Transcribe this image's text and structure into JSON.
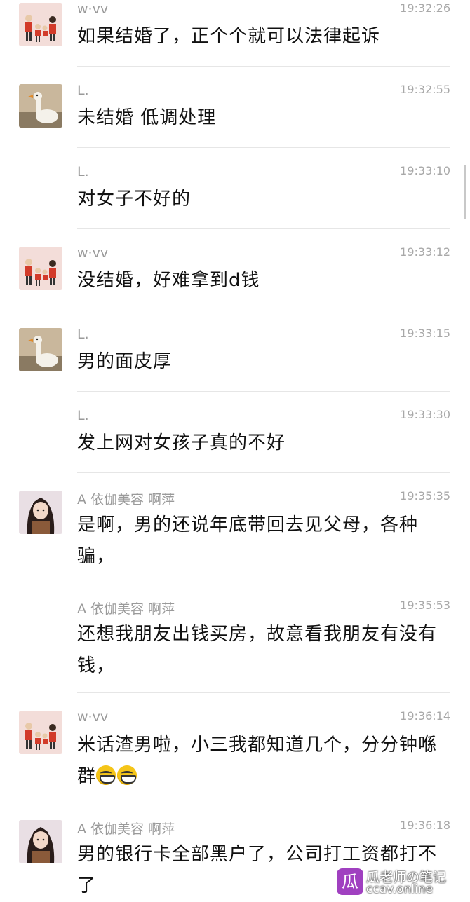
{
  "messages": [
    {
      "sender": "w·vv",
      "time": "19:32:26",
      "text": "如果结婚了，正个个就可以法律起诉",
      "avatar": "family-avatar"
    },
    {
      "sender": "L.",
      "time": "19:32:55",
      "text": "未结婚 低调处理",
      "avatar": "goose-avatar"
    },
    {
      "sender": "L.",
      "time": "19:33:10",
      "text": "对女子不好的",
      "avatar": ""
    },
    {
      "sender": "w·vv",
      "time": "19:33:12",
      "text": "没结婚，好难拿到d钱",
      "avatar": "family-avatar"
    },
    {
      "sender": "L.",
      "time": "19:33:15",
      "text": "男的面皮厚",
      "avatar": "goose-avatar"
    },
    {
      "sender": "L.",
      "time": "19:33:30",
      "text": "发上网对女孩子真的不好",
      "avatar": ""
    },
    {
      "sender": "A   依伽美容 啊萍",
      "time": "19:35:35",
      "text": "是啊，男的还说年底带回去见父母，各种骗，",
      "avatar": "girl-avatar"
    },
    {
      "sender": "A   依伽美容 啊萍",
      "time": "19:35:53",
      "text": "还想我朋友出钱买房，故意看我朋友有没有钱，",
      "avatar": ""
    },
    {
      "sender": "w·vv",
      "time": "19:36:14",
      "text": "米话渣男啦，小三我都知道几个，分分钟喺群",
      "avatar": "family-avatar",
      "emoji": [
        "grin-emoji",
        "grin-emoji"
      ]
    },
    {
      "sender": "A   依伽美容 啊萍",
      "time": "19:36:18",
      "text": "男的银行卡全部黑户了，公司打工资都打不了",
      "avatar": "girl-avatar"
    }
  ],
  "watermark": {
    "logo_char": "瓜",
    "title": "瓜老师の笔记",
    "url": "ccav.online"
  }
}
